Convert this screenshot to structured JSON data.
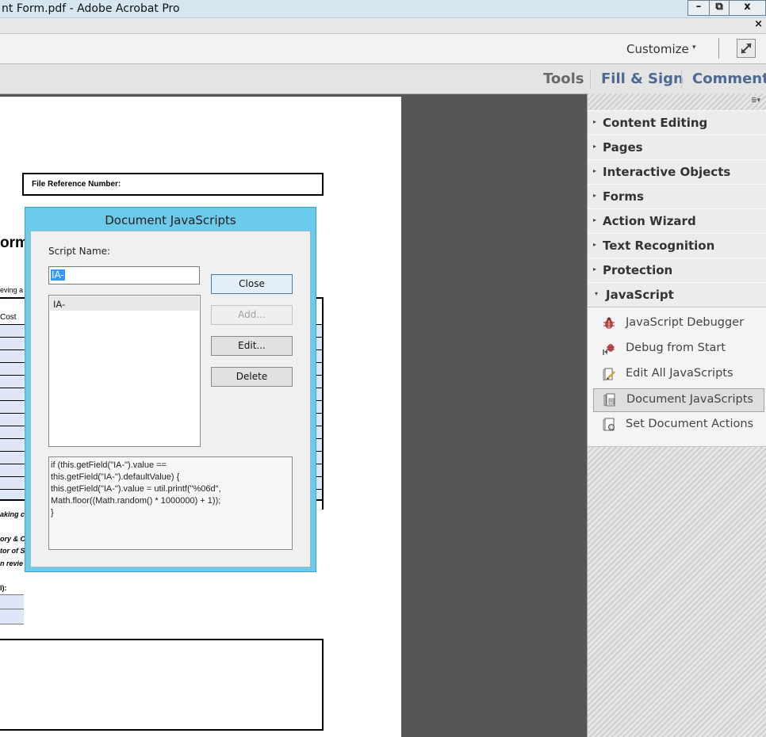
{
  "window": {
    "title": "nt Form.pdf - Adobe Acrobat Pro",
    "min_glyph": "–",
    "restore_glyph": "⧉",
    "close_glyph": "x",
    "doc_close_glyph": "×"
  },
  "toolbar": {
    "customize_label": "Customize",
    "customize_arrow": "▾"
  },
  "tabs": {
    "tools": "Tools",
    "fill_sign": "Fill & Sign",
    "comment": "Comment"
  },
  "right_pane": {
    "options_glyph": "≣▾",
    "panels": [
      {
        "label": "Content Editing",
        "expanded": false
      },
      {
        "label": "Pages",
        "expanded": false
      },
      {
        "label": "Interactive Objects",
        "expanded": false
      },
      {
        "label": "Forms",
        "expanded": false
      },
      {
        "label": "Action Wizard",
        "expanded": false
      },
      {
        "label": "Text Recognition",
        "expanded": false
      },
      {
        "label": "Protection",
        "expanded": false
      },
      {
        "label": "JavaScript",
        "expanded": true
      }
    ],
    "collapsed_arrow": "▸",
    "expanded_arrow": "▾",
    "javascript_items": [
      {
        "label": "JavaScript Debugger",
        "icon": "bug-icon",
        "selected": false
      },
      {
        "label": "Debug from Start",
        "icon": "bug-start-icon",
        "selected": false
      },
      {
        "label": "Edit All JavaScripts",
        "icon": "edit-scripts-icon",
        "selected": false
      },
      {
        "label": "Document JavaScripts",
        "icon": "document-scripts-icon",
        "selected": true
      },
      {
        "label": "Set Document Actions",
        "icon": "document-actions-icon",
        "selected": false
      }
    ]
  },
  "dialog": {
    "title": "Document JavaScripts",
    "script_name_label": "Script Name:",
    "script_name_value": "IA-",
    "scripts": [
      "IA-"
    ],
    "buttons": {
      "close": "Close",
      "add": "Add...",
      "edit": "Edit...",
      "delete": "Delete"
    },
    "code": "if (this.getField(\"IA-\").value ==\nthis.getField(\"IA-\").defaultValue) {\nthis.getField(\"IA-\").value = util.printf(\"%06d\",\nMath.floor((Math.random() * 1000000) + 1));\n}"
  },
  "document": {
    "file_reference_label": "File Reference Number:",
    "form_heading_fragment": "orm",
    "reviewing_fragment": "eving a",
    "cost_header": "Cost",
    "making_fragment": "aking c",
    "frag_1": "ory & C",
    "frag_2": "tor of S",
    "frag_3": "n revie",
    "frag_4": "l):"
  }
}
